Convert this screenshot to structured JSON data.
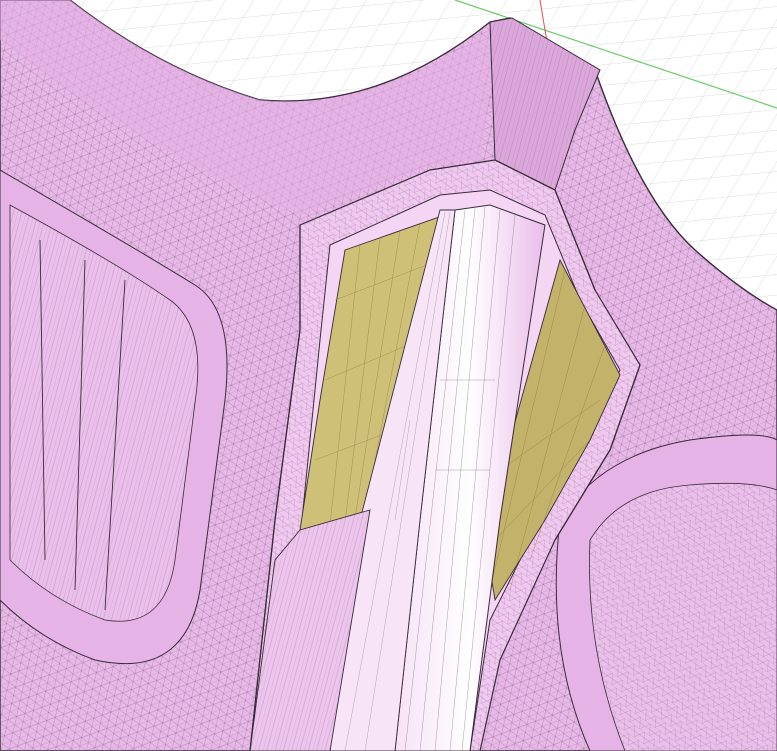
{
  "viewport": {
    "background": "#ffffff",
    "grid_color": "#c8c8c8",
    "axis_x_color": "#66cc66",
    "axis_y_color": "#e05050",
    "mesh": {
      "face_color": "#e8b8e8",
      "face_light": "#f3d4f3",
      "face_shadow": "#d59ed5",
      "edge_color": "#4a3a4a",
      "cavity_color": "#cfc078",
      "cavity_dark": "#b5a460"
    }
  }
}
